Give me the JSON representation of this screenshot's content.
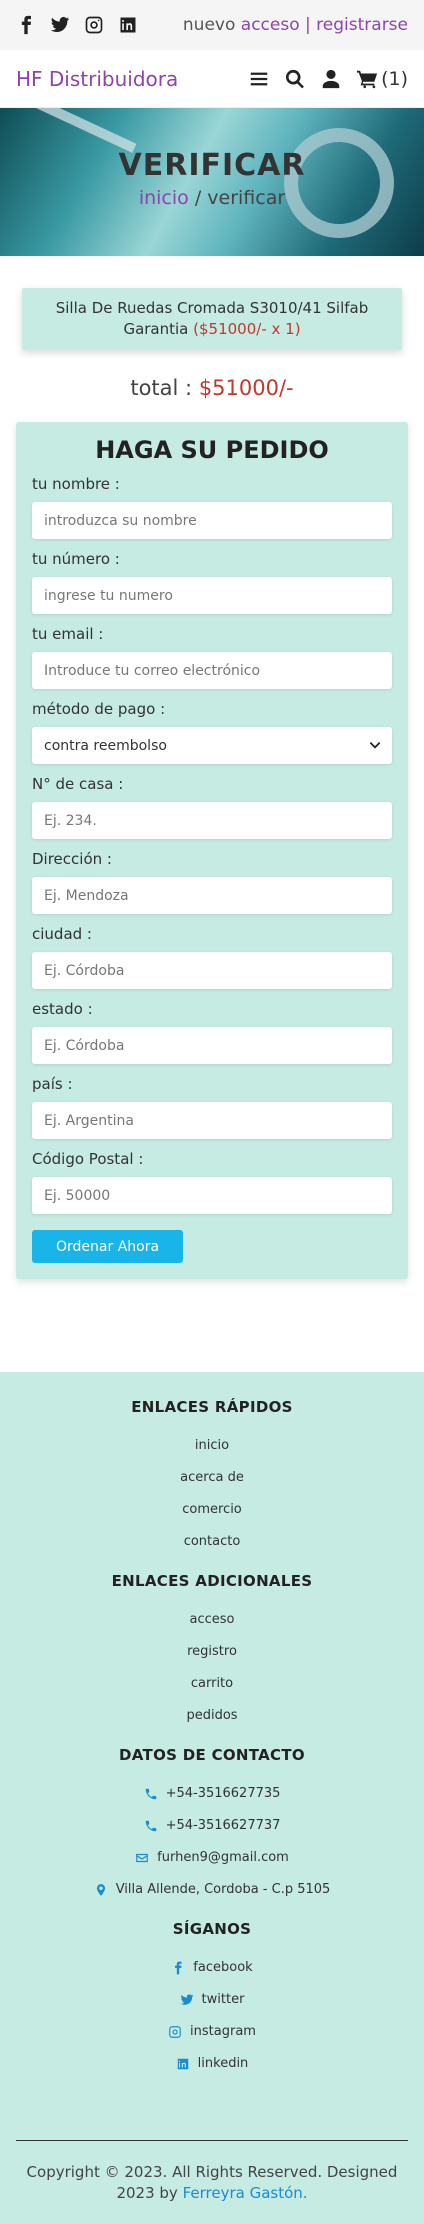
{
  "topbar": {
    "socials": [
      "facebook-icon",
      "twitter-icon",
      "instagram-icon",
      "linkedin-icon"
    ],
    "auth_prefix": "nuevo",
    "login": "acceso",
    "separator": "|",
    "register": "registrarse"
  },
  "navbar": {
    "brand": "HF Distribuidora",
    "cart_count": "(1)"
  },
  "hero": {
    "title": "VERIFICAR",
    "breadcrumb_home": "inicio",
    "breadcrumb_sep": " / ",
    "breadcrumb_current": "verificar"
  },
  "order_item": {
    "name": "Silla De Ruedas Cromada S3010/41 Silfab Garantia",
    "price": "($51000/- x 1)"
  },
  "total": {
    "label": "total :",
    "amount": "$51000/-"
  },
  "form": {
    "title": "HAGA SU PEDIDO",
    "fields": [
      {
        "label": "tu nombre :",
        "placeholder": "introduzca su nombre",
        "type": "text"
      },
      {
        "label": "tu número :",
        "placeholder": "ingrese tu numero",
        "type": "text"
      },
      {
        "label": "tu email :",
        "placeholder": "Introduce tu correo electrónico",
        "type": "text"
      },
      {
        "label": "método de pago :",
        "value": "contra reembolso",
        "type": "select"
      },
      {
        "label": "N° de casa :",
        "placeholder": "Ej. 234.",
        "type": "text"
      },
      {
        "label": "Dirección :",
        "placeholder": "Ej. Mendoza",
        "type": "text"
      },
      {
        "label": "ciudad :",
        "placeholder": "Ej. Córdoba",
        "type": "text"
      },
      {
        "label": "estado :",
        "placeholder": "Ej. Córdoba",
        "type": "text"
      },
      {
        "label": "país :",
        "placeholder": "Ej. Argentina",
        "type": "text"
      },
      {
        "label": "Código Postal :",
        "placeholder": "Ej. 50000",
        "type": "text"
      }
    ],
    "submit": "Ordenar Ahora"
  },
  "footer": {
    "quick_links": {
      "title": "ENLACES RÁPIDOS",
      "items": [
        "inicio",
        "acerca de",
        "comercio",
        "contacto"
      ]
    },
    "extra_links": {
      "title": "ENLACES ADICIONALES",
      "items": [
        "acceso",
        "registro",
        "carrito",
        "pedidos"
      ]
    },
    "contact": {
      "title": "DATOS DE CONTACTO",
      "items": [
        {
          "icon": "phone-icon",
          "text": "+54-3516627735"
        },
        {
          "icon": "phone-icon",
          "text": "+54-3516627737"
        },
        {
          "icon": "envelope-icon",
          "text": "furhen9@gmail.com"
        },
        {
          "icon": "map-marker-icon",
          "text": "Villa Allende, Cordoba - C.p 5105"
        }
      ]
    },
    "follow": {
      "title": "SÍGANOS",
      "items": [
        {
          "icon": "facebook-icon",
          "text": "facebook"
        },
        {
          "icon": "twitter-icon",
          "text": "twitter"
        },
        {
          "icon": "instagram-icon",
          "text": "instagram"
        },
        {
          "icon": "linkedin-icon",
          "text": "linkedin"
        }
      ]
    },
    "copyright": "Copyright © 2023. All Rights Reserved. Designed 2023 by",
    "author": "Ferreyra Gastón."
  },
  "colors": {
    "accent": "#8e44ad",
    "price": "#c0392b",
    "panel_bg": "#c5ebe3",
    "button": "#1ab5e8",
    "link_blue": "#1a8cd0"
  }
}
